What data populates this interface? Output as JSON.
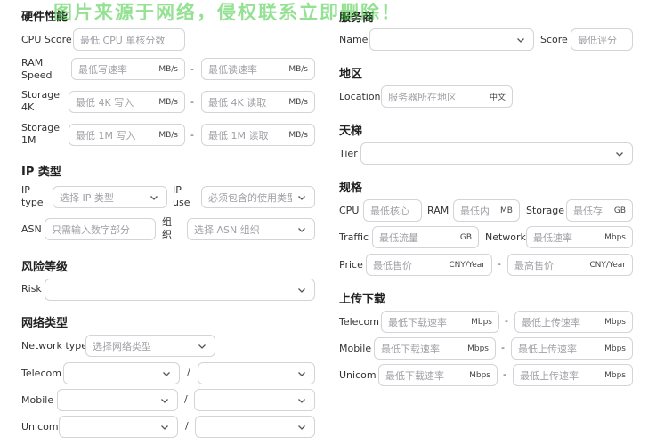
{
  "watermark": "图片来源于网络，侵权联系立即删除！",
  "left": {
    "hardware": {
      "title": "硬件性能",
      "cpu_label": "CPU Score",
      "cpu_placeholder": "最低 CPU 单核分数",
      "ram_label": "RAM Speed",
      "ram_write_placeholder": "最低写速率",
      "ram_read_placeholder": "最低读速率",
      "ram_unit": "MB/s",
      "s4k_label": "Storage 4K",
      "s4k_write_placeholder": "最低 4K 写入",
      "s4k_read_placeholder": "最低 4K 读取",
      "s4k_unit": "MB/s",
      "s1m_label": "Storage 1M",
      "s1m_write_placeholder": "最低 1M 写入",
      "s1m_read_placeholder": "最低 1M 读取",
      "s1m_unit": "MB/s",
      "sep": "-"
    },
    "ip": {
      "title": "IP 类型",
      "ip_type_label": "IP type",
      "ip_type_placeholder": "选择 IP 类型",
      "ip_use_label": "IP use",
      "ip_use_placeholder": "必须包含的使用类型",
      "asn_label": "ASN",
      "asn_placeholder": "只需输入数字部分",
      "org_label": "组织",
      "org_placeholder": "选择 ASN 组织"
    },
    "risk": {
      "title": "风险等级",
      "risk_label": "Risk"
    },
    "network": {
      "title": "网络类型",
      "type_label": "Network type",
      "type_placeholder": "选择网络类型",
      "telecom_label": "Telecom",
      "mobile_label": "Mobile",
      "unicom_label": "Unicom",
      "slash": "/"
    }
  },
  "right": {
    "provider": {
      "title": "服务商",
      "name_label": "Name",
      "score_label": "Score",
      "score_placeholder": "最低评分"
    },
    "region": {
      "title": "地区",
      "location_label": "Location",
      "location_placeholder": "服务器所在地区",
      "location_badge": "中文"
    },
    "tier": {
      "title": "天梯",
      "tier_label": "Tier"
    },
    "spec": {
      "title": "规格",
      "cpu_label": "CPU",
      "cpu_placeholder": "最低核心",
      "ram_label": "RAM",
      "ram_placeholder": "最低内",
      "ram_unit": "MB",
      "storage_label": "Storage",
      "storage_placeholder": "最低存",
      "storage_unit": "GB",
      "traffic_label": "Traffic",
      "traffic_placeholder": "最低流量",
      "traffic_unit": "GB",
      "network_label": "Network",
      "network_placeholder": "最低速率",
      "network_unit": "Mbps",
      "price_label": "Price",
      "price_min_placeholder": "最低售价",
      "price_max_placeholder": "最高售价",
      "price_unit": "CNY/Year",
      "sep": "-"
    },
    "transfer": {
      "title": "上传下载",
      "telecom_label": "Telecom",
      "mobile_label": "Mobile",
      "unicom_label": "Unicom",
      "down_placeholder": "最低下载速率",
      "up_placeholder": "最低上传速率",
      "unit": "Mbps",
      "sep": "-"
    }
  }
}
